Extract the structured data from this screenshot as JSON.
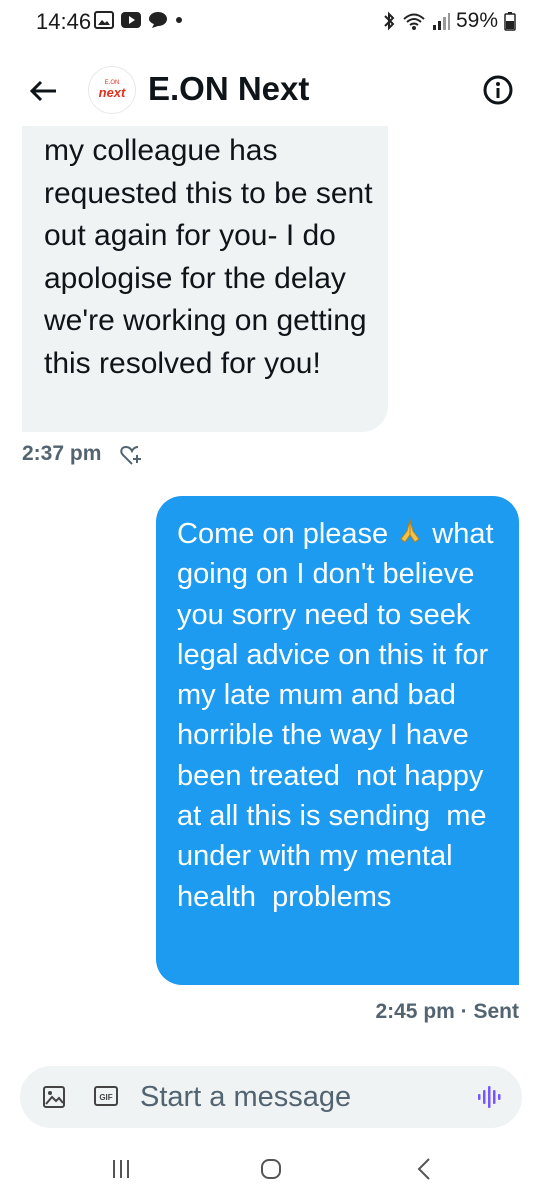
{
  "status_bar": {
    "time": "14:46",
    "battery": "59%"
  },
  "header": {
    "avatar_top": "E.ON",
    "avatar_brand": "next",
    "title": "E.ON Next"
  },
  "messages": [
    {
      "direction": "received",
      "text": "my colleague has requested this to be sent out again for you- I do apologise for the delay we're working on getting this resolved for you!",
      "time": "2:37 pm"
    },
    {
      "direction": "sent",
      "text": "Come on please ",
      "text_after_emoji": " what going on I don't believe you sorry need to seek legal advice on this it for my late mum and bad horrible the way I have been treated  not happy at all this is sending  me under with my mental health  problems",
      "time": "2:45 pm · Sent"
    }
  ],
  "composer": {
    "gif_label": "GIF",
    "placeholder": "Start a message"
  },
  "colors": {
    "sent_bubble": "#1d9bf0",
    "received_bubble": "#eff3f4",
    "brand": "#e2311d",
    "secondary_text": "#536471"
  }
}
